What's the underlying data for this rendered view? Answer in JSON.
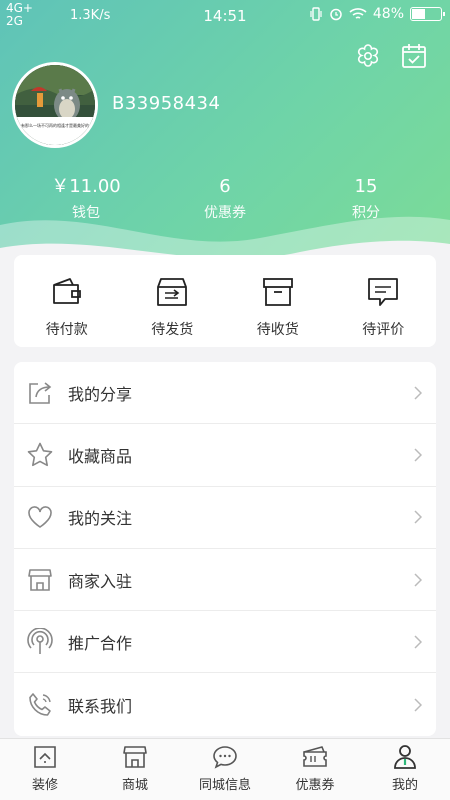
{
  "status_bar": {
    "network_top": "4G+",
    "network_bottom": "2G",
    "speed": "1.3K/s",
    "time": "14:51",
    "battery": "48%",
    "battery_level": 0.48
  },
  "profile": {
    "username": "B33958434",
    "avatar_caption": "有那么一场不可再的相逢才是最美好的"
  },
  "stats": [
    {
      "value": "￥11.00",
      "label": "钱包"
    },
    {
      "value": "6",
      "label": "优惠券"
    },
    {
      "value": "15",
      "label": "积分"
    }
  ],
  "orders": [
    {
      "label": "待付款",
      "icon": "wallet-icon"
    },
    {
      "label": "待发货",
      "icon": "box-send-icon"
    },
    {
      "label": "待收货",
      "icon": "archive-box-icon"
    },
    {
      "label": "待评价",
      "icon": "comment-icon"
    }
  ],
  "menu": [
    {
      "label": "我的分享",
      "icon": "share-icon"
    },
    {
      "label": "收藏商品",
      "icon": "star-icon"
    },
    {
      "label": "我的关注",
      "icon": "heart-icon"
    },
    {
      "label": "商家入驻",
      "icon": "store-icon"
    },
    {
      "label": "推广合作",
      "icon": "broadcast-icon"
    },
    {
      "label": "联系我们",
      "icon": "phone-icon"
    }
  ],
  "tabs": [
    {
      "label": "装修",
      "icon": "home-icon"
    },
    {
      "label": "商城",
      "icon": "shop-icon"
    },
    {
      "label": "同城信息",
      "icon": "chat-icon"
    },
    {
      "label": "优惠券",
      "icon": "ticket-icon"
    },
    {
      "label": "我的",
      "icon": "person-icon",
      "active": true
    }
  ],
  "colors": {
    "header_start": "#5fc3b8",
    "header_end": "#7ddc96",
    "icon_gray": "#888888",
    "active_green": "#2db77a"
  }
}
